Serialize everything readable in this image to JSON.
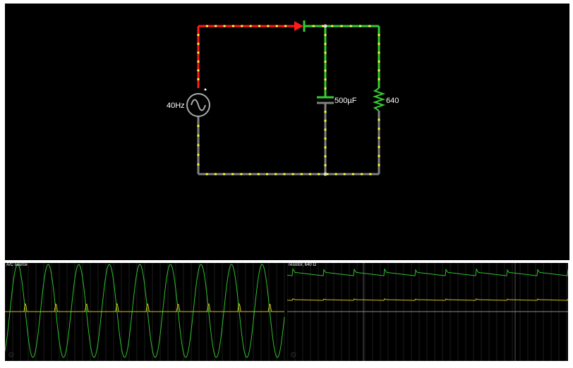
{
  "circuit": {
    "source_label": "40Hz",
    "capacitor_label": "500µF",
    "resistor_label": "640",
    "colors": {
      "high_voltage": "#ff1a1a",
      "mid_voltage": "#33cc33",
      "ground": "#808080",
      "current_dot": "#ffff33",
      "background": "#000000"
    }
  },
  "scopes": [
    {
      "title": "A/C source",
      "icon": "gear-icon"
    },
    {
      "title": "resistor, 640 Ω",
      "icon": "gear-icon"
    }
  ]
}
